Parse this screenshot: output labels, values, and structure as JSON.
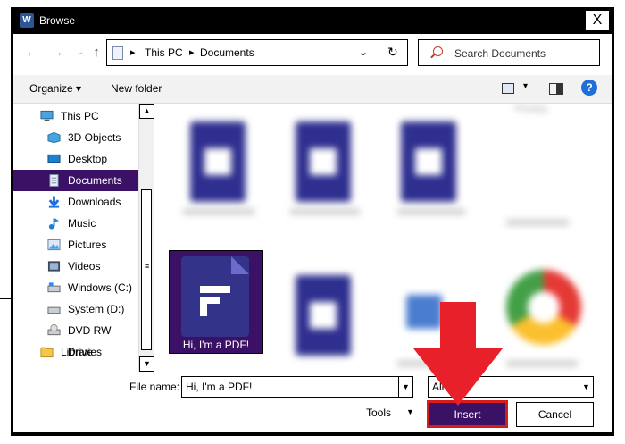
{
  "window": {
    "title": "Browse",
    "app_icon": "word-icon",
    "close_label": "X"
  },
  "address_bar": {
    "path": [
      "This PC",
      "Documents"
    ]
  },
  "search": {
    "placeholder": "Search Documents"
  },
  "toolbar": {
    "organize_label": "Organize",
    "new_folder_label": "New folder",
    "help_label": "?"
  },
  "sidebar": {
    "items": [
      {
        "label": "This PC",
        "icon": "computer-icon"
      },
      {
        "label": "3D Objects",
        "icon": "3d-objects-icon"
      },
      {
        "label": "Desktop",
        "icon": "desktop-icon"
      },
      {
        "label": "Documents",
        "icon": "documents-icon",
        "selected": true
      },
      {
        "label": "Downloads",
        "icon": "downloads-icon"
      },
      {
        "label": "Music",
        "icon": "music-icon"
      },
      {
        "label": "Pictures",
        "icon": "pictures-icon"
      },
      {
        "label": "Videos",
        "icon": "videos-icon"
      },
      {
        "label": "Windows (C:)",
        "icon": "drive-icon"
      },
      {
        "label": "System (D:)",
        "icon": "drive-icon"
      },
      {
        "label": "DVD RW Drive",
        "icon": "dvd-drive-icon"
      },
      {
        "label": "Libraries",
        "icon": "libraries-icon"
      }
    ]
  },
  "files": {
    "selected": {
      "label": "Hi, I'm a PDF!",
      "icon": "pdf-file-icon"
    },
    "blurred_label": "Privacy"
  },
  "footer": {
    "file_name_label": "File name:",
    "file_name_value": "Hi, I'm a PDF!",
    "file_type_value": "All Files",
    "tools_label": "Tools",
    "insert_label": "Insert",
    "cancel_label": "Cancel"
  },
  "colors": {
    "accent": "#3b1166",
    "highlight_border": "#d81b1b",
    "arrow": "#e8202a"
  }
}
